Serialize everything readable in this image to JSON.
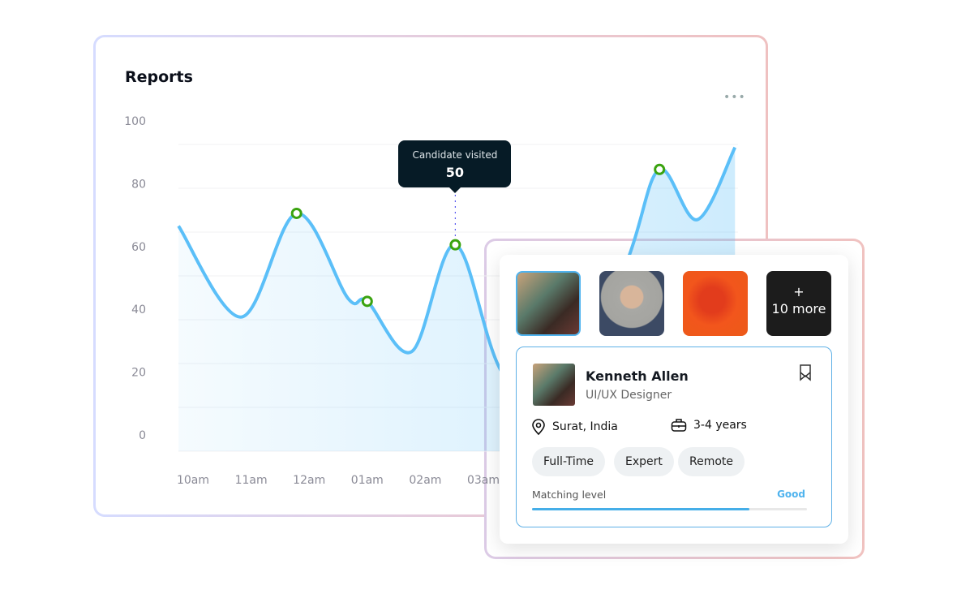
{
  "reports": {
    "title": "Reports",
    "menu_icon": "more-horizontal-icon"
  },
  "chart_data": {
    "type": "area",
    "title": "Reports",
    "yticks": [
      100,
      80,
      60,
      40,
      20,
      0
    ],
    "ylim": [
      0,
      100
    ],
    "xticks": [
      "10am",
      "11am",
      "12am",
      "01am",
      "02am",
      "03am"
    ],
    "grid": true,
    "line_color": "#5bbff8",
    "marker_color": "#3aa30f",
    "points": [
      {
        "x": "09:45",
        "y": 65
      },
      {
        "x": "10:50",
        "y": 36
      },
      {
        "x": "11:47",
        "y": 69,
        "marker": true
      },
      {
        "x": "12:40",
        "y": 42
      },
      {
        "x": "13:00",
        "y": 41,
        "marker": true
      },
      {
        "x": "13:46",
        "y": 25
      },
      {
        "x": "14:31",
        "y": 59,
        "marker": true
      },
      {
        "x": "15:20",
        "y": 18
      },
      {
        "x": "16:27",
        "y": 5
      },
      {
        "x": "17:30",
        "y": 55
      },
      {
        "x": "18:02",
        "y": 83,
        "marker": true
      },
      {
        "x": "18:41",
        "y": 67
      },
      {
        "x": "19:20",
        "y": 90
      }
    ],
    "tooltip": {
      "label": "Candidate visited",
      "value": "50",
      "x": "14:31"
    }
  },
  "candidates": {
    "thumbnails": [
      {
        "name": "candidate-photo-1",
        "selected": true
      },
      {
        "name": "candidate-photo-2"
      },
      {
        "name": "candidate-photo-3"
      }
    ],
    "more": {
      "plus": "+",
      "label": "10 more"
    },
    "profile": {
      "name": "Kenneth Allen",
      "role": "UI/UX Designer",
      "location": "Surat, India",
      "experience": "3-4 years",
      "tags": [
        "Full-Time",
        "Expert",
        "Remote"
      ],
      "matching_label": "Matching level",
      "matching_value": "Good",
      "matching_percent": 79,
      "accent": "#45aee8"
    }
  }
}
